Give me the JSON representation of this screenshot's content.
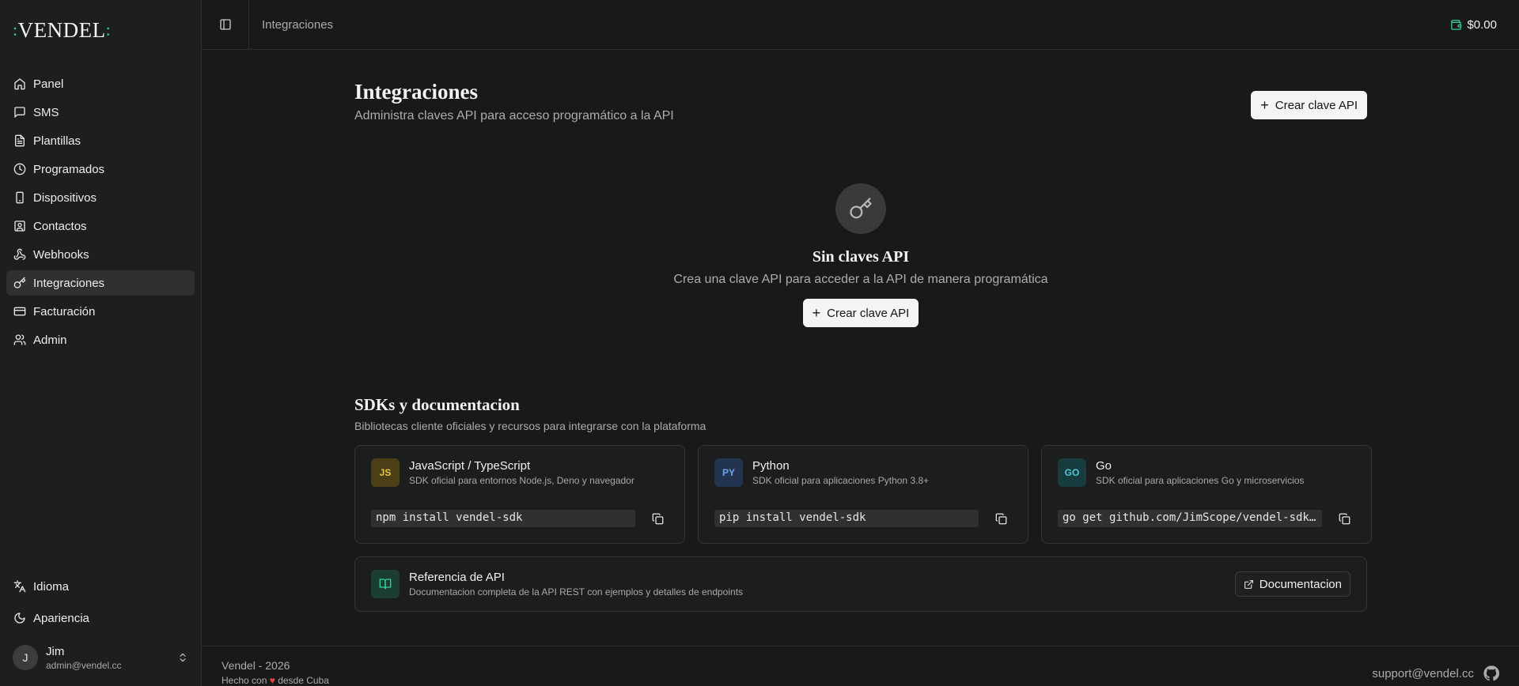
{
  "app": {
    "logo_text": "VENDEL",
    "logo_dots_left": ":",
    "logo_dots_right": ":"
  },
  "sidebar": {
    "items": [
      {
        "label": "Panel",
        "icon": "home-icon"
      },
      {
        "label": "SMS",
        "icon": "message-icon"
      },
      {
        "label": "Plantillas",
        "icon": "document-icon"
      },
      {
        "label": "Programados",
        "icon": "clock-icon"
      },
      {
        "label": "Dispositivos",
        "icon": "phone-icon"
      },
      {
        "label": "Contactos",
        "icon": "contacts-icon"
      },
      {
        "label": "Webhooks",
        "icon": "webhook-icon"
      },
      {
        "label": "Integraciones",
        "icon": "key-icon",
        "active": true
      },
      {
        "label": "Facturación",
        "icon": "credit-card-icon"
      },
      {
        "label": "Admin",
        "icon": "users-icon"
      }
    ],
    "language_label": "Idioma",
    "appearance_label": "Apariencia",
    "user": {
      "initial": "J",
      "name": "Jim",
      "email": "admin@vendel.cc"
    }
  },
  "topbar": {
    "breadcrumb": "Integraciones",
    "balance": "$0.00"
  },
  "page": {
    "title": "Integraciones",
    "subtitle": "Administra claves API para acceso programático a la API",
    "create_button": "Crear clave API"
  },
  "empty_state": {
    "title": "Sin claves API",
    "description": "Crea una clave API para acceder a la API de manera programática",
    "button": "Crear clave API"
  },
  "sdks": {
    "title": "SDKs y documentacion",
    "subtitle": "Bibliotecas cliente oficiales y recursos para integrarse con la plataforma",
    "cards": [
      {
        "badge": "JS",
        "name": "JavaScript / TypeScript",
        "description": "SDK oficial para entornos Node.js, Deno y navegador",
        "install": "npm install vendel-sdk"
      },
      {
        "badge": "PY",
        "name": "Python",
        "description": "SDK oficial para aplicaciones Python 3.8+",
        "install": "pip install vendel-sdk"
      },
      {
        "badge": "GO",
        "name": "Go",
        "description": "SDK oficial para aplicaciones Go y microservicios",
        "install": "go get github.com/JimScope/vendel-sdk-go"
      }
    ],
    "reference": {
      "title": "Referencia de API",
      "description": "Documentacion completa de la API REST con ejemplos y detalles de endpoints",
      "button": "Documentacion"
    }
  },
  "footer": {
    "left": "Vendel - 2026",
    "made_prefix": "Hecho con",
    "made_suffix": "desde Cuba",
    "support": "support@vendel.cc"
  },
  "colors": {
    "background": "#181a19",
    "sidebar": "#1d1f1e",
    "accent": "#34d399"
  }
}
